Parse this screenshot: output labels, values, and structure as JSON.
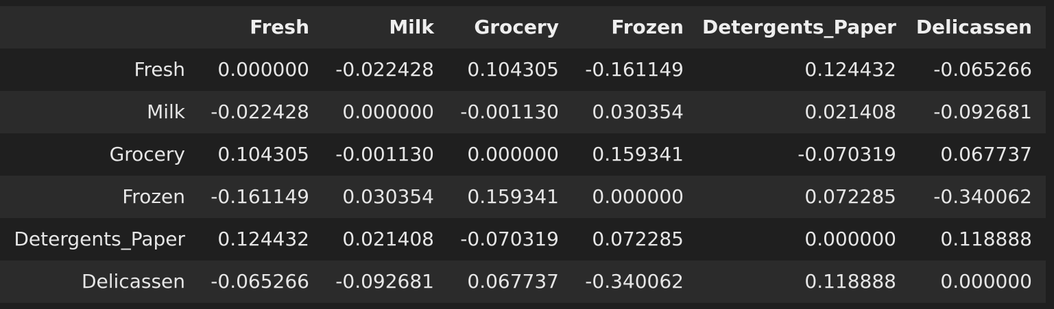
{
  "table": {
    "columns": [
      "",
      "Fresh",
      "Milk",
      "Grocery",
      "Frozen",
      "Detergents_Paper",
      "Delicassen"
    ],
    "rows": [
      {
        "label": "Fresh",
        "values": [
          "0.000000",
          "-0.022428",
          "0.104305",
          "-0.161149",
          "0.124432",
          "-0.065266"
        ]
      },
      {
        "label": "Milk",
        "values": [
          "-0.022428",
          "0.000000",
          "-0.001130",
          "0.030354",
          "0.021408",
          "-0.092681"
        ]
      },
      {
        "label": "Grocery",
        "values": [
          "0.104305",
          "-0.001130",
          "0.000000",
          "0.159341",
          "-0.070319",
          "0.067737"
        ]
      },
      {
        "label": "Frozen",
        "values": [
          "-0.161149",
          "0.030354",
          "0.159341",
          "0.000000",
          "0.072285",
          "-0.340062"
        ]
      },
      {
        "label": "Detergents_Paper",
        "values": [
          "0.124432",
          "0.021408",
          "-0.070319",
          "0.072285",
          "0.000000",
          "0.118888"
        ]
      },
      {
        "label": "Delicassen",
        "values": [
          "-0.065266",
          "-0.092681",
          "0.067737",
          "-0.340062",
          "0.118888",
          "0.000000"
        ]
      }
    ]
  },
  "colors": {
    "background": "#1f1f1f",
    "stripe": "#2b2b2b",
    "text": "#e6e6e6"
  }
}
